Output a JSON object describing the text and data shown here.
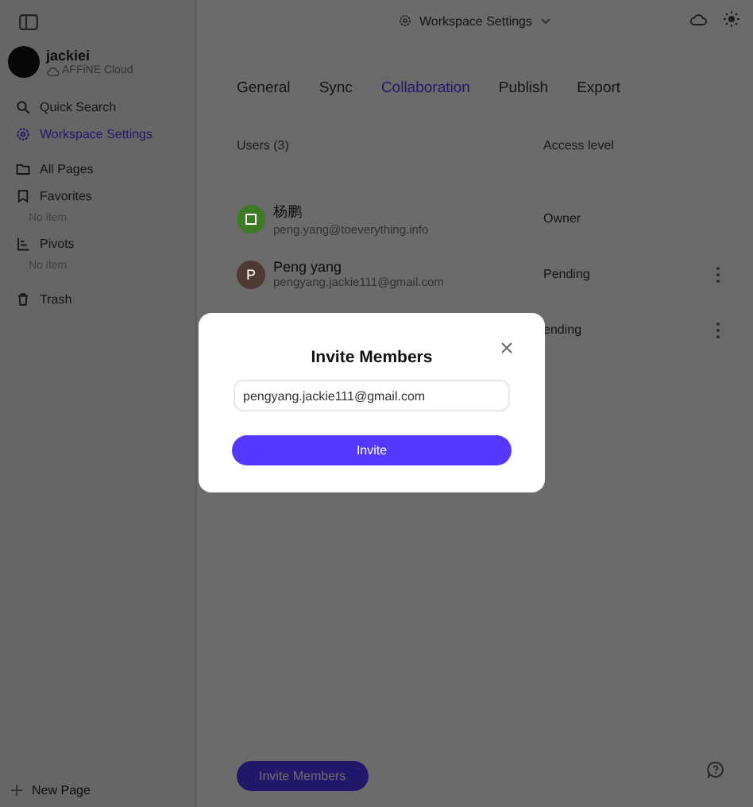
{
  "sidebar": {
    "workspace": {
      "name": "jackiei",
      "sync": "AFFiNE Cloud"
    },
    "items": [
      {
        "kind": "search",
        "label": "Quick Search",
        "selected": false
      },
      {
        "kind": "settings",
        "label": "Workspace Settings",
        "selected": true
      },
      {
        "kind": "pages",
        "label": "All Pages",
        "selected": false
      },
      {
        "kind": "favorites",
        "label": "Favorites",
        "selected": false,
        "empty": "No item"
      },
      {
        "kind": "pivots",
        "label": "Pivots",
        "selected": false,
        "empty": "No item"
      },
      {
        "kind": "trash",
        "label": "Trash",
        "selected": false
      }
    ],
    "new_page": "New Page"
  },
  "header": {
    "title": "Workspace Settings"
  },
  "tabs": [
    {
      "label": "General",
      "selected": false
    },
    {
      "label": "Sync",
      "selected": false
    },
    {
      "label": "Collaboration",
      "selected": true
    },
    {
      "label": "Publish",
      "selected": false
    },
    {
      "label": "Export",
      "selected": false
    }
  ],
  "users": {
    "heading": "Users (3)",
    "access_heading": "Access level",
    "rows": [
      {
        "name": "杨鹏",
        "email": "peng.yang@toeverything.info",
        "access": "Owner",
        "color": "#3d7a24",
        "menu": false
      },
      {
        "name": "Peng yang",
        "email": "pengyang.jackie111@gmail.com",
        "access": "Pending",
        "color": "#4e3a33",
        "initial": "P",
        "menu": true
      },
      {
        "access": "ending",
        "menu": true
      }
    ]
  },
  "invite_button": "Invite Members",
  "dialog": {
    "title": "Invite Members",
    "email": "pengyang.jackie111@gmail.com",
    "button": "Invite"
  }
}
